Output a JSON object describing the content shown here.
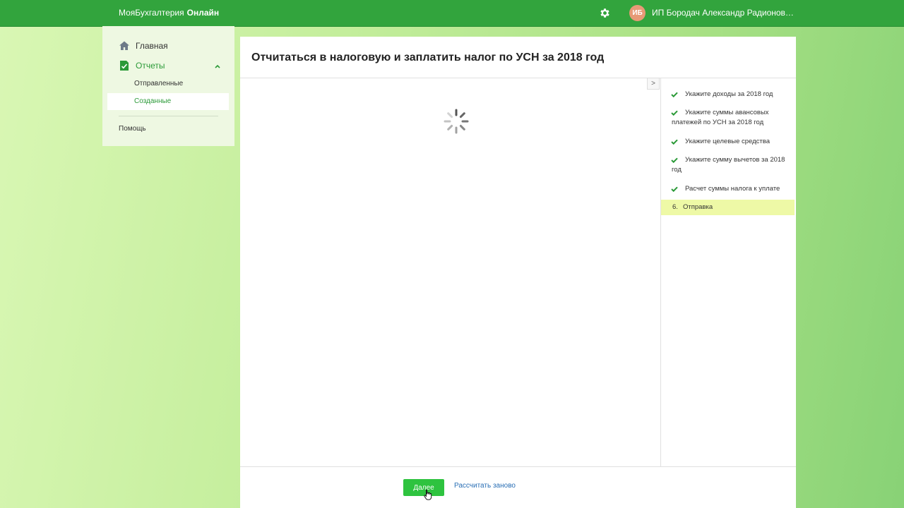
{
  "header": {
    "brand_main": "МояБухгалтерия",
    "brand_suffix": "Онлайн",
    "settings_icon": "gear-icon",
    "avatar_initials": "ИБ",
    "user_name": "ИП Бородач Александр Радионов…",
    "colors": {
      "bar": "#32a43d",
      "avatar": "#e79a77"
    }
  },
  "sidebar": {
    "items": [
      {
        "label": "Главная",
        "icon": "home-icon"
      },
      {
        "label": "Отчеты",
        "icon": "report-icon",
        "expanded": true
      }
    ],
    "subitems": [
      {
        "label": "Отправленные"
      },
      {
        "label": "Созданные",
        "selected": true
      }
    ],
    "help_label": "Помощь"
  },
  "main": {
    "title": "Отчитаться в налоговую и заплатить налог по УСН за 2018 год",
    "collapse_label": ">",
    "loading": true,
    "steps": [
      {
        "label": "Укажите доходы за 2018 год",
        "done": true
      },
      {
        "label": "Укажите суммы авансовых платежей по УСН за 2018 год",
        "done": true
      },
      {
        "label": "Укажите целевые средства",
        "done": true
      },
      {
        "label": "Укажите сумму вычетов за 2018 год",
        "done": true
      },
      {
        "label": "Расчет суммы налога к уплате",
        "done": true
      },
      {
        "number": "6.",
        "label": "Отправка",
        "active": true
      }
    ],
    "next_button": "Далее",
    "recalc_link": "Рассчитать заново",
    "colors": {
      "accent": "#2ec33f",
      "check": "#2b9a38",
      "active_step": "#eef9a6",
      "link": "#2a6fb5"
    }
  }
}
